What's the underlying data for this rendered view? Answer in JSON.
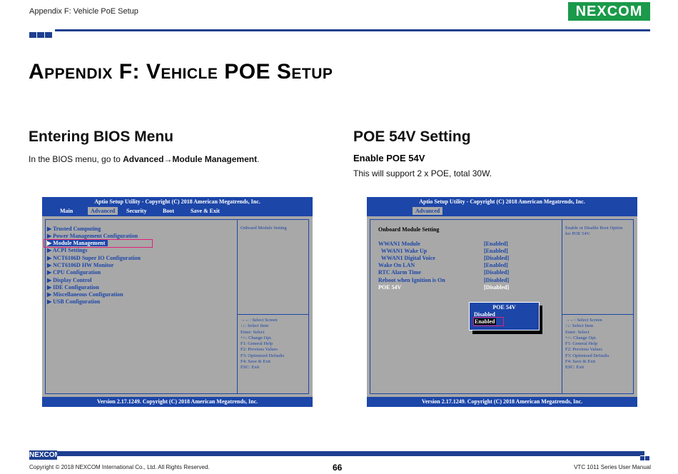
{
  "header": {
    "section": "Appendix F: Vehicle PoE Setup",
    "logo": "NEXCOM",
    "brand_color": "#1d3f8f",
    "logo_color": "#1a9a4a"
  },
  "title": "Appendix F: Vehicle POE Setup",
  "left": {
    "heading": "Entering BIOS Menu",
    "para_prefix": "In the BIOS menu, go to ",
    "para_bold": "Advanced→Module Management",
    "para_suffix": "."
  },
  "right": {
    "heading": "POE 54V Setting",
    "subheading": "Enable POE 54V",
    "para": "This will support 2 x POE, total 30W."
  },
  "bios1": {
    "topbar": "Aptio Setup Utility - Copyright (C) 2018 American Megatrends, Inc.",
    "tabs": [
      "Main",
      "Advanced",
      "Security",
      "Boot",
      "Save & Exit"
    ],
    "active_tab": "Advanced",
    "items": [
      "▶ Trusted Computing",
      "▶ Power Management Configuration",
      "▶ Module Management",
      "▶ ACPI Settings",
      "▶ NCT6106D Super IO Configuration",
      "▶ NCT6106D HW Monitor",
      "▶ CPU Configuration",
      "▶ Display Control",
      "▶ IDE Configuration",
      "▶ Miscellaneous Configuration",
      "▶ USB Configuration"
    ],
    "highlighted_item": "▶ Module Management",
    "help_top": "Onboard Module Setting",
    "help_keys": "→←: Select Screen\n↑↓: Select Item\nEnter: Select\n+/-: Change Opt.\nF1: General Help\nF2: Previous Values\nF3: Optimized Defaults\nF4: Save & Exit\nESC: Exit",
    "bottombar": "Version 2.17.1249. Copyright (C) 2018 American Megatrends, Inc."
  },
  "bios2": {
    "topbar": "Aptio Setup Utility - Copyright (C) 2018 American Megatrends, Inc.",
    "active_tab": "Advanced",
    "section_title": "Onboard Module Setting",
    "rows": [
      {
        "label": "WWAN1 Module",
        "value": "[Enabled]"
      },
      {
        "label": "  WWAN1 Wake Up",
        "value": "[Enabled]"
      },
      {
        "label": "  WWAN1 Digital Voice",
        "value": "[Disabled]"
      },
      {
        "label": "Wake On LAN",
        "value": "[Enabled]"
      },
      {
        "label": "RTC Alarm Time",
        "value": "[Disabled]"
      },
      {
        "label": "Reboot when Ignition is On",
        "value": "[Disabled]"
      },
      {
        "label": "POE 54V",
        "value": "[Disabled]"
      }
    ],
    "help_top": "Enable or Disable Boot Option\nfor POE 54V.",
    "help_keys": "→←: Select Screen\n↑↓: Select Item\nEnter: Select\n+/-: Change Opt.\nF1: General Help\nF2: Previous Values\nF3: Optimized Defaults\nF4: Save & Exit\nESC: Exit",
    "popup": {
      "title": "POE 54V",
      "options": [
        "Disabled",
        "Enabled"
      ],
      "selected": "Enabled"
    },
    "bottombar": "Version 2.17.1249. Copyright (C) 2018 American Megatrends, Inc."
  },
  "footer": {
    "logo": "NEXCOM",
    "copyright": "Copyright © 2018 NEXCOM International Co., Ltd. All Rights Reserved.",
    "page": "66",
    "manual": "VTC 1011 Series User Manual"
  }
}
